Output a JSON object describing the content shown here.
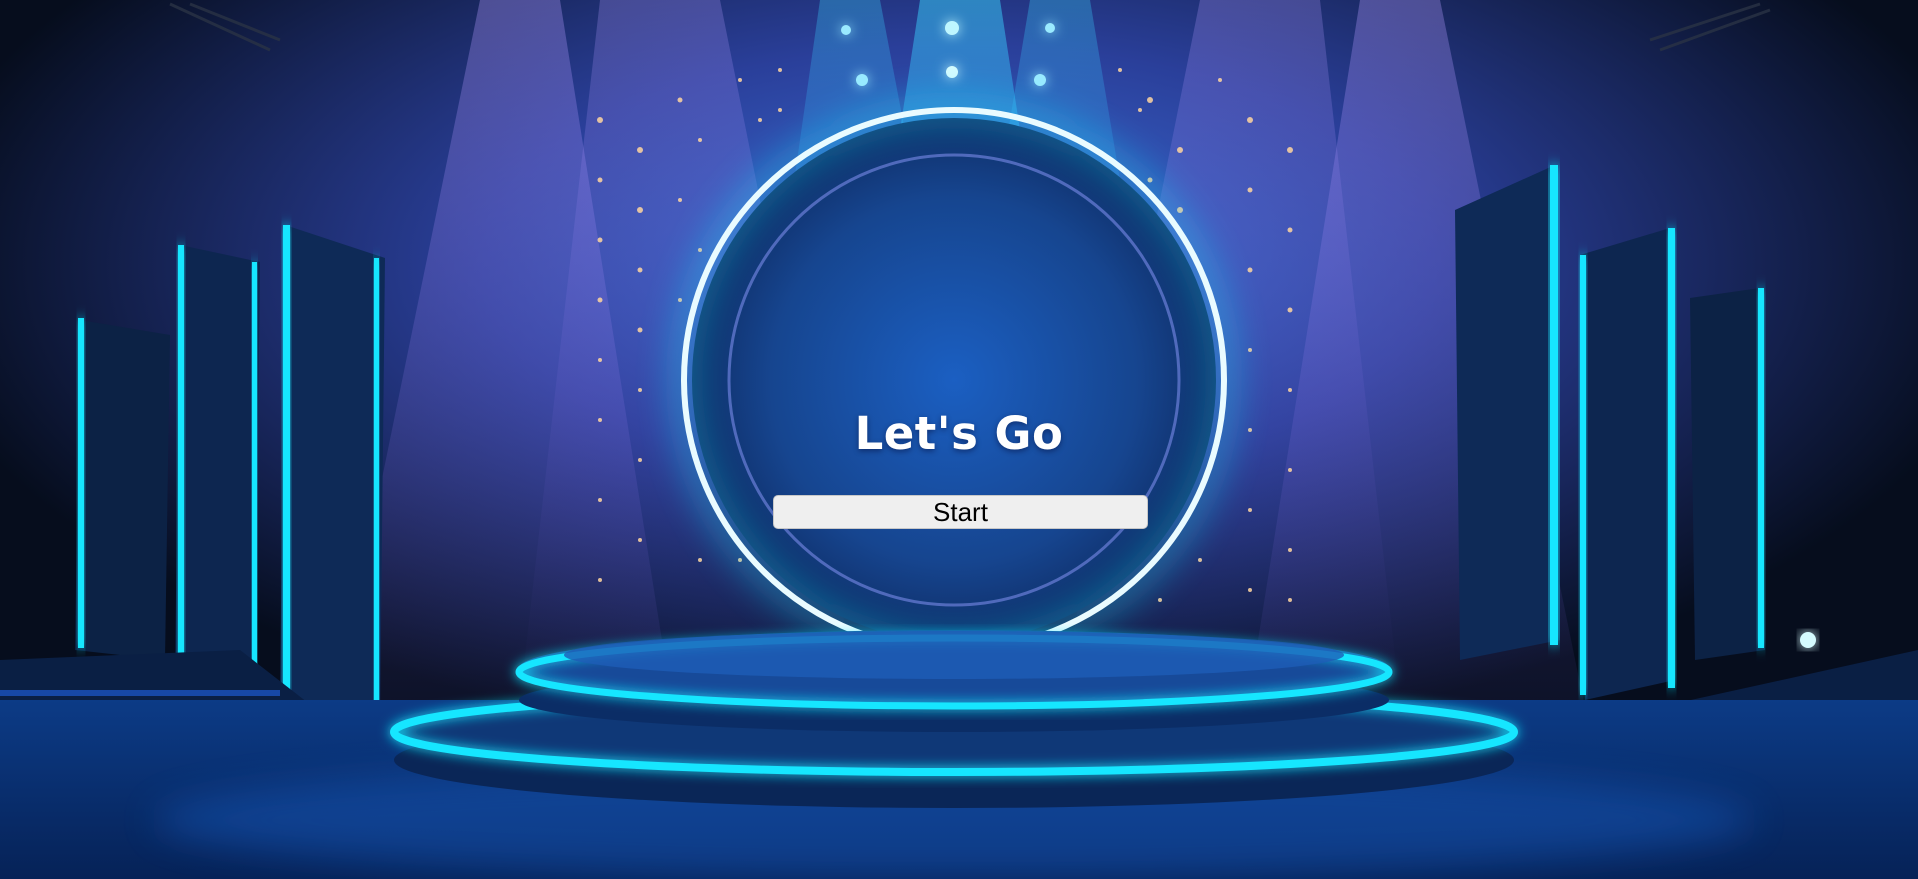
{
  "screen": {
    "title": "Let's Go",
    "start_label": "Start"
  },
  "theme": {
    "neon": "#19e6ff",
    "ring": "#e9fbff",
    "haze": "#8a6fe0",
    "button_bg": "#efefef"
  },
  "icons": {
    "background": "neon-stage-backdrop"
  }
}
